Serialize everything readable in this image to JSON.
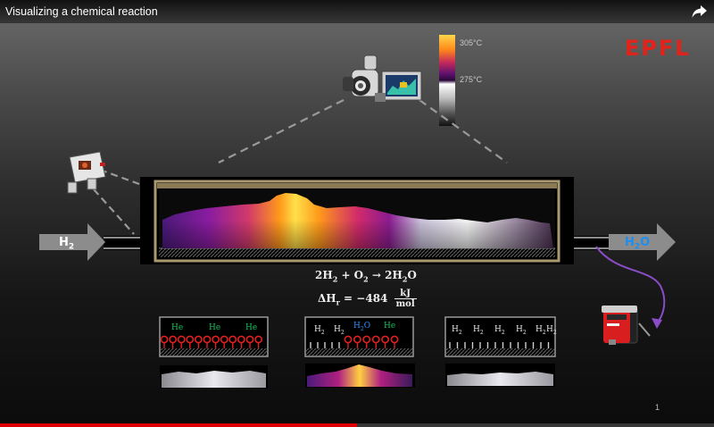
{
  "video": {
    "title": "Visualizing a chemical reaction",
    "share_icon": "share-icon",
    "progress_fraction": 0.5,
    "slide_number": "1"
  },
  "logo": {
    "text": "EPFL",
    "color": "#e2231a"
  },
  "temperature_scale": {
    "high_label": "305°C",
    "mid_label": "275°C"
  },
  "reactor": {
    "inlet_label": "H",
    "inlet_sub": "2",
    "outlet_label": "H",
    "outlet_sub": "2",
    "outlet_tail": "O",
    "outlet_color": "#1a8ff0"
  },
  "equation": {
    "reaction": {
      "a": "2H",
      "a_sub": "2",
      "plus": " + O",
      "b_sub": "2",
      "arrow": " → 2H",
      "c_sub": "2",
      "c_tail": "O"
    },
    "enthalpy": {
      "lhs": "ΔH",
      "lhs_sub": "r",
      "mid": " = −484",
      "num": "kJ",
      "den": "mol"
    }
  },
  "panels": [
    {
      "labels": [
        "He",
        "He",
        "He"
      ],
      "label_colors": [
        "#19c25a",
        "#19c25a",
        "#19c25a"
      ]
    },
    {
      "labels": [
        "H2",
        "H2",
        "H2O",
        "He"
      ],
      "label_colors": [
        "#e8e8e8",
        "#e8e8e8",
        "#2f8fff",
        "#19c25a"
      ]
    },
    {
      "labels": [
        "H2",
        "H2",
        "H2",
        "H2",
        "H2",
        "H2"
      ],
      "label_colors": [
        "#e8e8e8",
        "#e8e8e8",
        "#e8e8e8",
        "#e8e8e8",
        "#e8e8e8",
        "#e8e8e8"
      ]
    }
  ]
}
